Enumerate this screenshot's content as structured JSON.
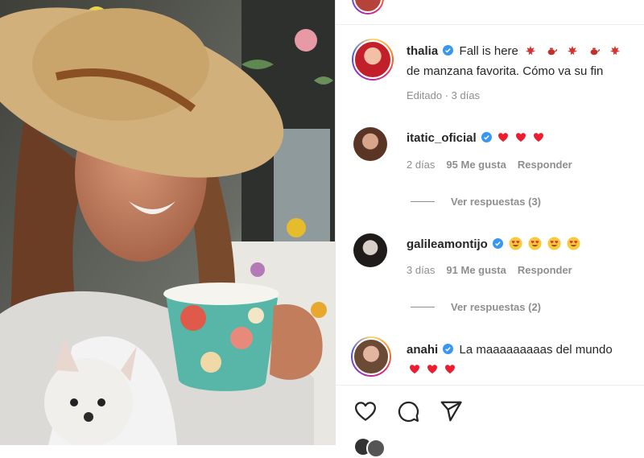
{
  "post": {
    "author": "thalia",
    "caption_line1": "Fall is here",
    "caption_line2": "de manzana favorita. Cómo va su fin",
    "meta": "Editado · 3 días"
  },
  "comments": [
    {
      "user": "itatic_oficial",
      "text_emoji": "hearts",
      "time": "2 días",
      "likes": "95 Me gusta",
      "reply": "Responder",
      "view_replies": "Ver respuestas (3)"
    },
    {
      "user": "galileamontijo",
      "text_emoji": "heart-eyes",
      "time": "3 días",
      "likes": "91 Me gusta",
      "reply": "Responder",
      "view_replies": "Ver respuestas (2)"
    },
    {
      "user": "anahi",
      "text": "La maaaaaaaaas del mundo"
    }
  ],
  "icons": [
    "heart-icon",
    "comment-icon",
    "share-icon",
    "verified-badge-icon"
  ],
  "colors": {
    "verified": "#3897f0",
    "heart": "#ed4956",
    "text": "#262626",
    "muted": "#8e8e8e"
  }
}
